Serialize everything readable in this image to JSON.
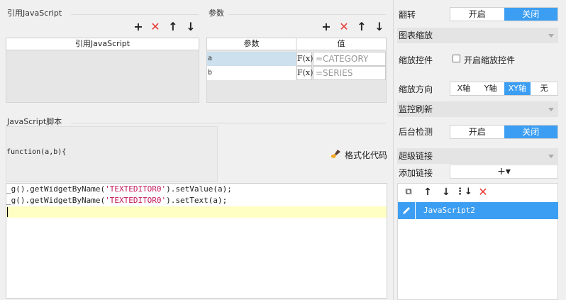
{
  "left_panel": {
    "ref_js_title": "引用JavaScript",
    "ref_js_column": "引用JavaScript",
    "params_title": "参数",
    "params_columns": [
      "参数",
      "值"
    ],
    "params_rows": [
      {
        "name": "a",
        "fx": "F(x)",
        "value": "=CATEGORY"
      },
      {
        "name": "b",
        "fx": "F(x)",
        "value": "=SERIES"
      }
    ],
    "script_title": "JavaScript脚本",
    "function_signature": "function(a,b){",
    "format_code_label": "格式化代码",
    "code_lines": [
      {
        "pre": "_g().getWidgetByName(",
        "str": "'TEXTEDITOR0'",
        "post": ").setValue(a);"
      },
      {
        "pre": "_g().getWidgetByName(",
        "str": "'TEXTEDITOR0'",
        "post": ").setText(a);"
      }
    ]
  },
  "right_panel": {
    "flip_label": "翻转",
    "flip_on": "开启",
    "flip_off": "关闭",
    "chart_zoom_header": "图表缩放",
    "zoom_control_label": "缩放控件",
    "enable_zoom_label": "开启缩放控件",
    "zoom_direction_label": "缩放方向",
    "zoom_directions": [
      "X轴",
      "Y轴",
      "XY轴",
      "无"
    ],
    "zoom_direction_selected": "XY轴",
    "monitor_header": "监控刷新",
    "bg_check_label": "后台检测",
    "bg_on": "开启",
    "bg_off": "关闭",
    "hyperlink_header": "超级链接",
    "add_link_label": "添加链接",
    "add_link_button": "+▾",
    "link_items": [
      "JavaScript2"
    ]
  },
  "colors": {
    "accent": "#3c9ef2",
    "selected_row": "#cce0ee",
    "current_line": "#ffffc4",
    "string": "#c2185b",
    "delete": "#e53935"
  }
}
